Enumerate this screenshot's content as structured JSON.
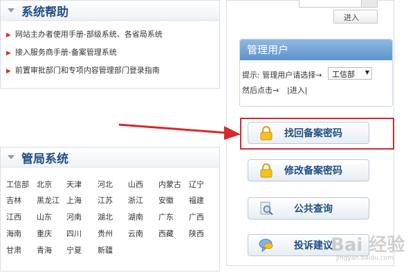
{
  "help": {
    "title": "系统帮助",
    "items": [
      "网站主办者使用手册-部级系统、各省局系统",
      "接入服务商手册-备案管理系统",
      "前置审批部门和专项内容管理部门登录指南"
    ]
  },
  "bureau": {
    "title": "管局系统",
    "regions": [
      [
        "工信部",
        "北京",
        "天津",
        "河北",
        "山西",
        "内蒙古",
        "辽宁"
      ],
      [
        "吉林",
        "黑龙江",
        "上海",
        "江苏",
        "浙江",
        "安徽",
        "福建"
      ],
      [
        "江西",
        "山东",
        "河南",
        "湖北",
        "湖南",
        "广东",
        "广西"
      ],
      [
        "海南",
        "重庆",
        "四川",
        "贵州",
        "云南",
        "西藏",
        "陕西"
      ],
      [
        "甘肃",
        "青海",
        "宁夏",
        "新疆"
      ]
    ]
  },
  "login": {
    "enter_label": "进入"
  },
  "manager": {
    "title": "管理用户",
    "hint": "提示: 管理用户请选择→",
    "select_value": "工信部",
    "then": "然后点击→",
    "enter_link": "|进入|"
  },
  "buttons": {
    "retrieve": "找回备案密码",
    "modify": "修改备案密码",
    "query": "公共查询",
    "complaint": "投诉建议"
  },
  "watermark": {
    "logo": "Bai 经验",
    "url": "jingyan.baidu.com"
  },
  "colors": {
    "highlight": "#d9272d",
    "title": "#1f4f86",
    "manager_header": "#5d93cc"
  }
}
